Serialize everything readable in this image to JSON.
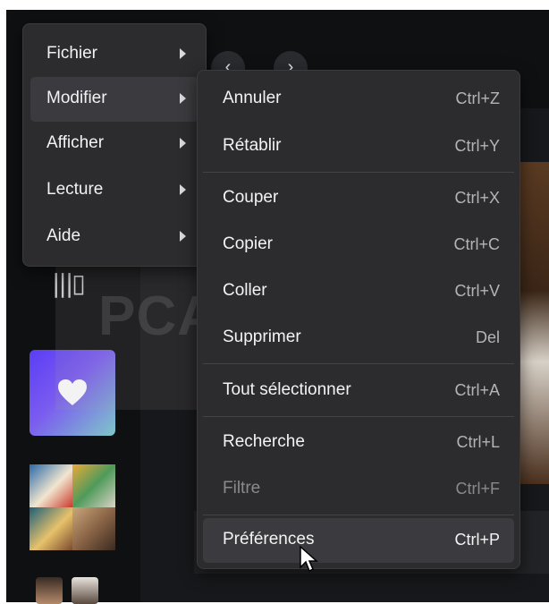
{
  "watermark": "PCACTUCES",
  "menubar": {
    "items": [
      {
        "label": "Fichier"
      },
      {
        "label": "Modifier"
      },
      {
        "label": "Afficher"
      },
      {
        "label": "Lecture"
      },
      {
        "label": "Aide"
      }
    ],
    "active_item": "Modifier"
  },
  "submenu": {
    "items": [
      {
        "label": "Annuler",
        "shortcut": "Ctrl+Z"
      },
      {
        "label": "Rétablir",
        "shortcut": "Ctrl+Y"
      },
      {
        "label": "Couper",
        "shortcut": "Ctrl+X"
      },
      {
        "label": "Copier",
        "shortcut": "Ctrl+C"
      },
      {
        "label": "Coller",
        "shortcut": "Ctrl+V"
      },
      {
        "label": "Supprimer",
        "shortcut": "Del"
      },
      {
        "label": "Tout sélectionner",
        "shortcut": "Ctrl+A"
      },
      {
        "label": "Recherche",
        "shortcut": "Ctrl+L"
      },
      {
        "label": "Filtre",
        "shortcut": "Ctrl+F",
        "disabled": true
      },
      {
        "label": "Préférences",
        "shortcut": "Ctrl+P",
        "hovered": true
      }
    ]
  },
  "icons": {
    "back": "chevron-left-icon",
    "forward": "chevron-right-icon",
    "library": "library-icon",
    "favorites": "heart-icon",
    "cursor": "mouse-pointer-icon"
  },
  "colors": {
    "menu_bg": "#2c2c2e",
    "menu_highlight": "#3b3b3f",
    "text": "#f2f2f2",
    "shortcut_text": "#b4b4b4",
    "disabled_text": "#8a8a8a",
    "favorites_gradient_start": "#5b3df5",
    "favorites_gradient_end": "#7fc7c9"
  }
}
